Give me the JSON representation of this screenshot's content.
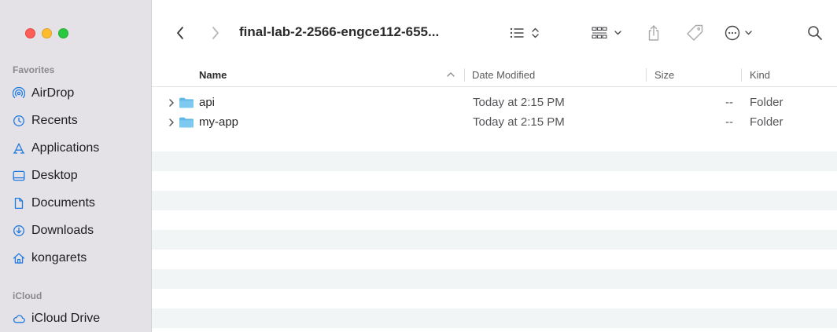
{
  "window": {
    "title": "final-lab-2-2566-engce112-655..."
  },
  "sidebar": {
    "favorites_title": "Favorites",
    "favorites": [
      {
        "label": "AirDrop",
        "icon": "airdrop-icon"
      },
      {
        "label": "Recents",
        "icon": "clock-icon"
      },
      {
        "label": "Applications",
        "icon": "applications-icon"
      },
      {
        "label": "Desktop",
        "icon": "desktop-icon"
      },
      {
        "label": "Documents",
        "icon": "document-icon"
      },
      {
        "label": "Downloads",
        "icon": "download-icon"
      },
      {
        "label": "kongarets",
        "icon": "home-icon"
      }
    ],
    "icloud_title": "iCloud",
    "icloud": [
      {
        "label": "iCloud Drive",
        "icon": "cloud-icon"
      }
    ]
  },
  "columns": {
    "name": "Name",
    "date_modified": "Date Modified",
    "size": "Size",
    "kind": "Kind"
  },
  "files": [
    {
      "name": "api",
      "date_modified": "Today at 2:15 PM",
      "size": "--",
      "kind": "Folder"
    },
    {
      "name": "my-app",
      "date_modified": "Today at 2:15 PM",
      "size": "--",
      "kind": "Folder"
    }
  ],
  "colors": {
    "accent_folder": "#5fb8e6",
    "sidebar_bg": "#e4e2e6",
    "sidebar_icon": "#1f7ae0",
    "row_alt": "#f2f5f5"
  }
}
